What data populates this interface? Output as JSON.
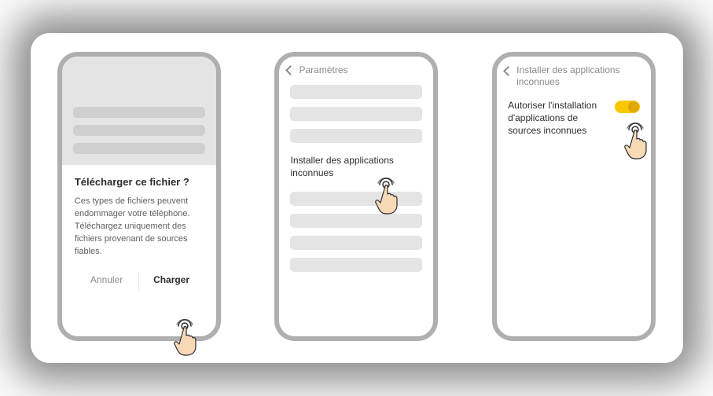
{
  "phone1": {
    "dialog_title": "Télécharger ce fichier ?",
    "dialog_body": "Ces types de fichiers peuvent endommager votre téléphone. Téléchargez uniquement des fichiers provenant de sources fiables.",
    "cancel_label": "Annuler",
    "confirm_label": "Charger"
  },
  "phone2": {
    "back_label": "Paramètres",
    "link_label": "Installer des applications inconnues"
  },
  "phone3": {
    "back_label": "Installer des applications inconnues",
    "toggle_label": "Autoriser l'installation d'applications de sources inconnues",
    "toggle_state": true
  }
}
